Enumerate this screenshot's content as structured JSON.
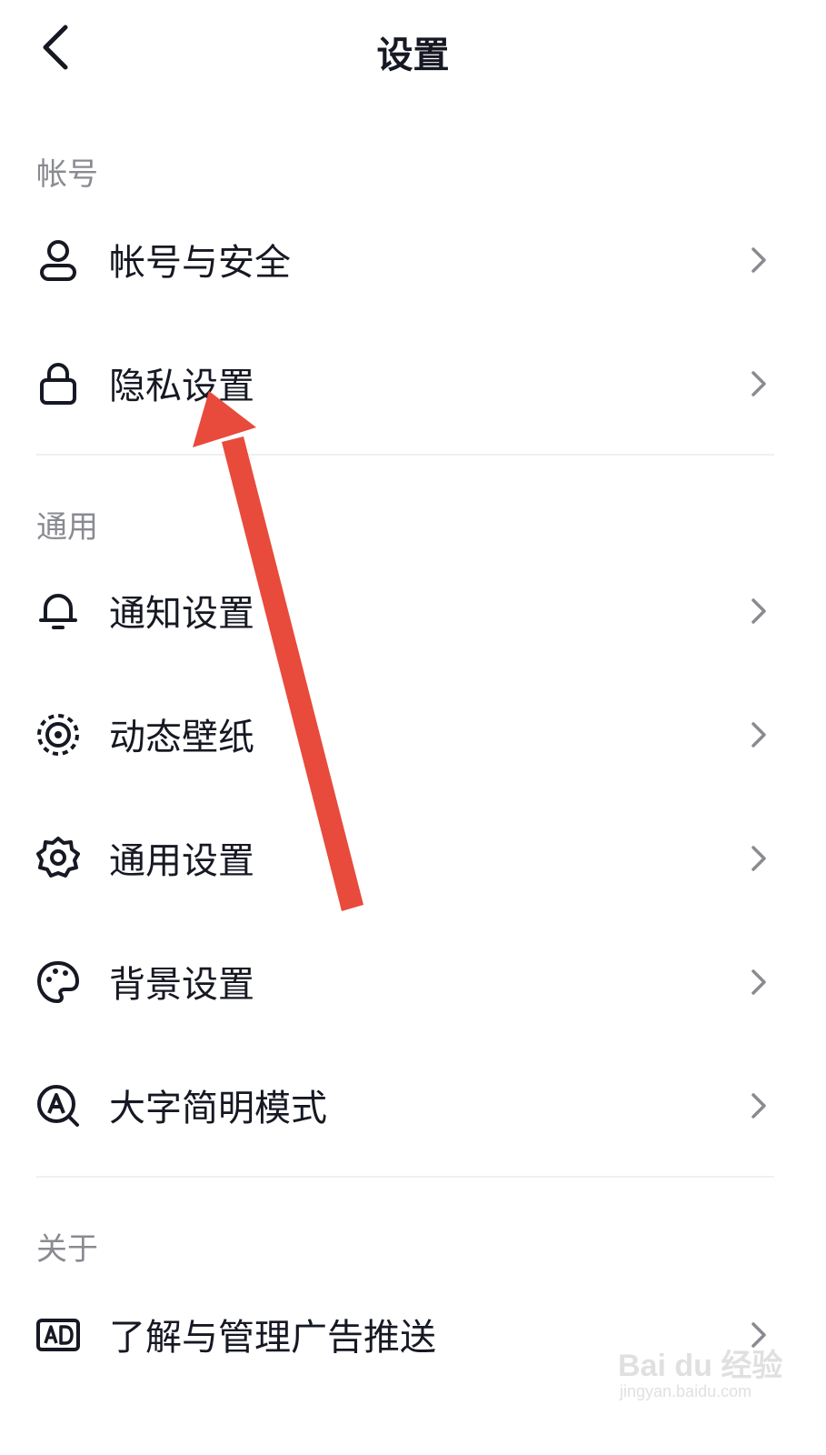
{
  "header": {
    "title": "设置",
    "back_icon": "chevron-left-icon"
  },
  "sections": [
    {
      "label": "帐号",
      "items": [
        {
          "label": "帐号与安全",
          "icon": "user-icon"
        },
        {
          "label": "隐私设置",
          "icon": "lock-icon"
        }
      ]
    },
    {
      "label": "通用",
      "items": [
        {
          "label": "通知设置",
          "icon": "bell-icon"
        },
        {
          "label": "动态壁纸",
          "icon": "dynamic-wallpaper-icon"
        },
        {
          "label": "通用设置",
          "icon": "gear-icon"
        },
        {
          "label": "背景设置",
          "icon": "palette-icon"
        },
        {
          "label": "大字简明模式",
          "icon": "large-text-icon"
        }
      ]
    },
    {
      "label": "关于",
      "items": [
        {
          "label": "了解与管理广告推送",
          "icon": "ad-icon"
        }
      ]
    }
  ],
  "annotation": {
    "type": "red-arrow",
    "color": "#e84a3c",
    "points_to": "隐私设置"
  },
  "watermark": {
    "main": "Bai du 经验",
    "sub": "jingyan.baidu.com"
  }
}
